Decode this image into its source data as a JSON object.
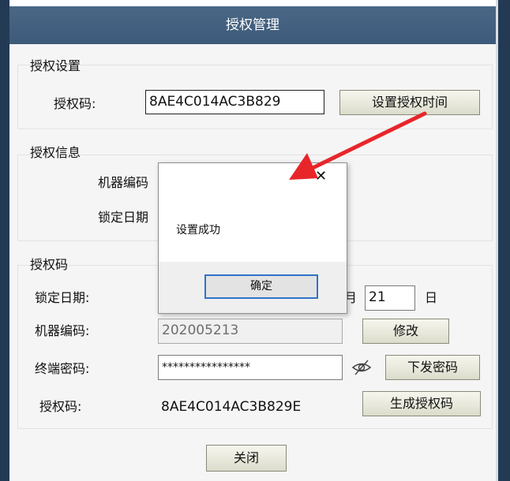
{
  "window": {
    "title": "授权管理"
  },
  "settings": {
    "title": "授权设置",
    "code_label": "授权码:",
    "code_value": "8AE4C014AC3B829",
    "set_time_button": "设置授权时间"
  },
  "info": {
    "title": "授权信息",
    "machine_label_partial": "机器编码",
    "lock_label_partial": "锁定日期"
  },
  "code_section": {
    "title": "授权码",
    "lock_date_label": "锁定日期:",
    "month_suffix": "月",
    "day_value": "21",
    "day_suffix": "日",
    "machine_label": "机器编码:",
    "machine_value": "202005213",
    "modify_button": "修改",
    "terminal_label": "终端密码:",
    "terminal_value": "****************",
    "send_button": "下发密码",
    "auth_label": "授权码:",
    "auth_value": "8AE4C014AC3B829E",
    "generate_button": "生成授权码"
  },
  "close_button": "关闭",
  "dialog": {
    "close_glyph": "✕",
    "message": "设置成功",
    "ok_button": "确定"
  },
  "colors": {
    "titlebar": "#3d5a7a",
    "arrow": "#e8262a",
    "focus_border": "#2e74c9"
  },
  "icons": {
    "hide_password": "eye-slash-icon"
  }
}
